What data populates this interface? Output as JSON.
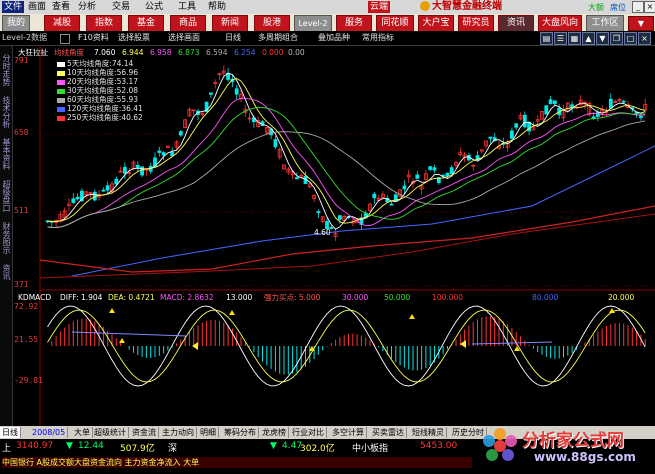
{
  "menubar": {
    "items": [
      "文件",
      "画面",
      "查看",
      "分析",
      "交易",
      "公式",
      "工具",
      "帮助"
    ],
    "tag": "云端",
    "brand": "大智慧金融终端",
    "right_items": [
      "大额",
      "席位"
    ]
  },
  "toolbar": {
    "buttons": [
      "我的",
      "减股",
      "指数",
      "基金",
      "商品",
      "新闻",
      "股港",
      "Level-2",
      "服务",
      "同花顺",
      "大户宝",
      "研究员",
      "资讯",
      "大盘风向",
      "工作区"
    ]
  },
  "toolbar2": {
    "account": "Level-2数据",
    "items": [
      "F10资料",
      "选择股票",
      "选择画面",
      "日线",
      "多周期组合",
      "叠加品种",
      "常用指标"
    ]
  },
  "left_tabs": [
    "分时走势",
    "技术分析",
    "基本资料",
    "超级盘口",
    "财务图示",
    "资讯"
  ],
  "main": {
    "header": "大狂拉扯",
    "indicator_name": "均线角度",
    "indicator_values": [
      "7.060",
      "6.944",
      "6.958",
      "6.873",
      "6.594",
      "6.254",
      "0.000",
      "0.00"
    ],
    "price_axis": [
      "791",
      "658",
      "511",
      "371"
    ],
    "legend": [
      {
        "label": "5天均线角度:",
        "value": "74.14",
        "color": "#ffffff"
      },
      {
        "label": "10天均线角度:",
        "value": "56.96",
        "color": "#ffff55"
      },
      {
        "label": "20天均线角度:",
        "value": "53.17",
        "color": "#ff55ff"
      },
      {
        "label": "30天均线角度:",
        "value": "52.08",
        "color": "#33dd33"
      },
      {
        "label": "60天均线角度:",
        "value": "55.93",
        "color": "#aaaaaa"
      },
      {
        "label": "120天均线角度:",
        "value": "36.41",
        "color": "#4466ff"
      },
      {
        "label": "250天均线角度:",
        "value": "40.62",
        "color": "#ff3333"
      }
    ],
    "low_label": "4.60"
  },
  "macd": {
    "label": "KDMACD",
    "items": [
      "DIFF: 1.904",
      "DEA: 0.4721",
      "MACD: 2.8632",
      "13.000",
      "强力买点: 5.000",
      "30.000",
      "50.000",
      "100.000",
      "80.000",
      "20.000"
    ],
    "axis": [
      "72.92",
      "21.55",
      "-29.81"
    ]
  },
  "chart_data": {
    "type": "line",
    "title": "大狂拉扯",
    "price_range": [
      371,
      791
    ],
    "note": "candlestick price chart with 7 moving averages and a KD/MACD sub-panel"
  },
  "bottom_tabs": {
    "period": "日线",
    "date_range": "2008/05",
    "items": [
      "大单",
      "超级统计",
      "资金流",
      "主力动向",
      "明细",
      "筹码分布",
      "龙虎榜",
      "行业对比",
      "多空计算",
      "买卖雷达",
      "短线精灵",
      "历史分时"
    ]
  },
  "statusbar": {
    "index1_name": "上",
    "index1_value": "3140.97",
    "index1_change": "12.44",
    "index1_amount": "507.9亿",
    "index2_name": "深",
    "index2_change": "4.47",
    "index2_amount": "302.0亿",
    "market_label": "中小板指",
    "market_value": "5453.00",
    "ticker_text": "中国银行 A股成交额大盘资金流向 主力资金净流入 大单"
  },
  "watermark": {
    "title": "分析家公式网",
    "url": "www.88gs.com"
  },
  "colors": {
    "bg": "#000000",
    "up": "#ff3333",
    "down": "#00ffff",
    "toolbar_red": "#c0141c"
  }
}
